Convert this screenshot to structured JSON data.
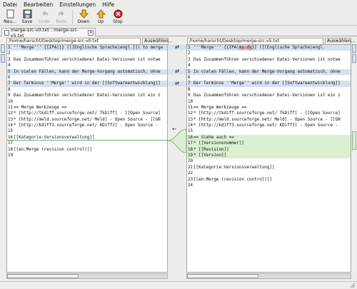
{
  "menu": [
    "Datei",
    "Bearbeiten",
    "Einstellungen",
    "Hilfe"
  ],
  "toolbar": {
    "new": "Neu...",
    "save": "Save",
    "undo": "Undo",
    "redo": "Redo",
    "down": "Down",
    "up": "Up",
    "stop": "Stop"
  },
  "tab": {
    "label": "merge-src-v0.txt : merge-src-v5.txt"
  },
  "left": {
    "path": "/home/harscht/Desktop/merge-src-v0.txt",
    "browse": "Auswählen...",
    "lines": [
      {
        "n": "1",
        "t": "'''Merge''' {{IPA|}} ([[Englische Sprache|engl.]]) to merge",
        "hl": "blue"
      },
      {
        "n": "2",
        "t": "",
        "hl": ""
      },
      {
        "n": "3",
        "t": "Das Zusammenführen verschiedener Datei-Versionen ist notwe",
        "hl": ""
      },
      {
        "n": "4",
        "t": "",
        "hl": ""
      },
      {
        "n": "5",
        "t": "In vielen Fällen, kann der Merge-Vorgang automatisch, ohne",
        "hl": "blue"
      },
      {
        "n": "6",
        "t": "",
        "hl": ""
      },
      {
        "n": "7",
        "t": "Der Terminus ''Merge'' wird in der [[Softwareentwicklung]]",
        "hl": "blue"
      },
      {
        "n": "8",
        "t": "",
        "hl": ""
      },
      {
        "n": "9",
        "t": "Das Zusammenführen verschiedener Datei-Versionen ist ein z",
        "hl": ""
      },
      {
        "n": "10",
        "t": "",
        "hl": ""
      },
      {
        "n": "11",
        "t": "== Merge Werkzeuge ==",
        "hl": ""
      },
      {
        "n": "12",
        "t": "* [http://tkdiff.sourceforge.net/ TkDiff] - [[Open Source]",
        "hl": ""
      },
      {
        "n": "13",
        "t": "* [http://meld.sourceforge.net/ Meld] - Open Source - [[GN",
        "hl": ""
      },
      {
        "n": "14",
        "t": "* [http://kdiff3.sourceforge.net/ KDiff3] - Open Source -",
        "hl": ""
      },
      {
        "n": "15",
        "t": "",
        "hl": ""
      },
      {
        "n": "16",
        "t": "[[Kategorie:Versionsverwaltung]]",
        "hl": ""
      },
      {
        "n": "17",
        "t": "",
        "hl": ""
      },
      {
        "n": "18",
        "t": "[[en:Merge (revision control)]]",
        "hl": ""
      },
      {
        "n": "19",
        "t": "",
        "hl": ""
      }
    ]
  },
  "right": {
    "path": "/home/harscht/Desktop/merge-src-v5.txt",
    "browse": "Auswählen...",
    "lines": [
      {
        "n": "1",
        "t": "'''Merge''' {{IPA|",
        "t2": "mɜːdʒ",
        "t3": "}} ([[Englische Sprache|engl.",
        "hl": "blue"
      },
      {
        "n": "2",
        "t": "",
        "hl": ""
      },
      {
        "n": "3",
        "t": "Das Zusammenführen verschiedener Datei-Versionen ist notwe",
        "hl": ""
      },
      {
        "n": "4",
        "t": "",
        "hl": ""
      },
      {
        "n": "5",
        "t": "In vielen Fällen, kann der Merge-Vorgang automatisch, ohne",
        "hl": "blue"
      },
      {
        "n": "6",
        "t": "",
        "hl": ""
      },
      {
        "n": "7",
        "t": "Der Terminus ''Merge'' wird in der [[Softwareentwicklung]]",
        "hl": "blue"
      },
      {
        "n": "8",
        "t": "",
        "hl": ""
      },
      {
        "n": "9",
        "t": "Das Zusammenführen verschiedener Datei-Versionen ist ein z",
        "hl": ""
      },
      {
        "n": "10",
        "t": "",
        "hl": ""
      },
      {
        "n": "11",
        "t": "== Merge Werkzeuge ==",
        "hl": ""
      },
      {
        "n": "12",
        "t": "* [http://tkdiff.sourceforge.net/ TkDiff] - [[Open Source]",
        "hl": ""
      },
      {
        "n": "13",
        "t": "* [http://meld.sourceforge.net/ Meld] - Open Source - [[GN",
        "hl": ""
      },
      {
        "n": "14",
        "t": "* [http://kdiff3.sourceforge.net/ KDiff3] - Open Source -",
        "hl": ""
      },
      {
        "n": "15",
        "t": "",
        "hl": ""
      },
      {
        "n": "16",
        "t": "== Siehe auch ==",
        "hl": "green"
      },
      {
        "n": "17",
        "t": "* [[Versionsnummer]]",
        "hl": "green"
      },
      {
        "n": "18",
        "t": "* [[Revision]]",
        "hl": "green"
      },
      {
        "n": "19",
        "t": "* [[Version]]",
        "hl": "green"
      },
      {
        "n": "20",
        "t": "",
        "hl": ""
      },
      {
        "n": "21",
        "t": "[[Kategorie:Versionsverwaltung]]",
        "hl": ""
      },
      {
        "n": "22",
        "t": "",
        "hl": ""
      },
      {
        "n": "23",
        "t": "[[en:Merge (revision control)]]",
        "hl": ""
      },
      {
        "n": "24",
        "t": "",
        "hl": ""
      }
    ]
  },
  "colors": {
    "changed": "#d6e1ef",
    "inserted": "#daf0d0",
    "accent": "#3c6eb4"
  }
}
